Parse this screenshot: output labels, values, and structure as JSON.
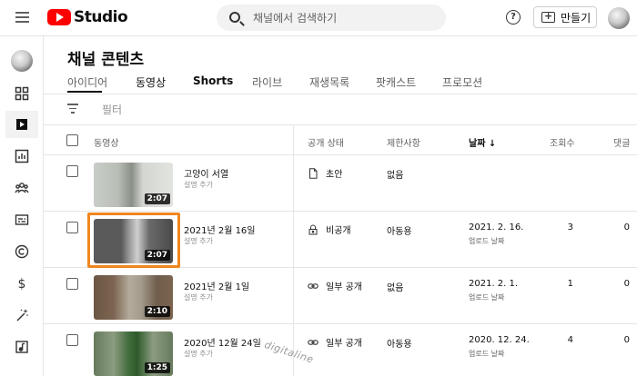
{
  "app": {
    "logo_text": "Studio"
  },
  "header": {
    "search_placeholder": "채널에서 검색하기",
    "help_symbol": "?",
    "create_label": "만들기"
  },
  "sidebar": {
    "items": [
      {
        "icon": "dashboard-icon",
        "active": false
      },
      {
        "icon": "content-icon",
        "active": true
      },
      {
        "icon": "analytics-icon",
        "active": false
      },
      {
        "icon": "community-icon",
        "active": false
      },
      {
        "icon": "subtitles-icon",
        "active": false
      },
      {
        "icon": "copyright-icon",
        "active": false
      },
      {
        "icon": "earn-icon",
        "active": false
      },
      {
        "icon": "customization-icon",
        "active": false
      },
      {
        "icon": "audio-library-icon",
        "active": false
      }
    ]
  },
  "page": {
    "title": "채널 콘텐츠"
  },
  "tabs": [
    {
      "label": "아이디어",
      "active": false
    },
    {
      "label": "동영상",
      "active": true
    },
    {
      "label": "Shorts",
      "active": false
    },
    {
      "label": "라이브",
      "active": false
    },
    {
      "label": "재생목록",
      "active": false
    },
    {
      "label": "팟캐스트",
      "active": false
    },
    {
      "label": "프로모션",
      "active": false
    }
  ],
  "filter": {
    "label": "필터"
  },
  "table": {
    "headers": {
      "video": "동영상",
      "visibility": "공개 상태",
      "restrictions": "제한사항",
      "date": "날짜 ↓",
      "views": "조회수",
      "comments": "댓글"
    },
    "rows": [
      {
        "title": "고양이 서열",
        "subtitle": "설명 추가",
        "duration": "2:07",
        "visibility": "초안",
        "visibility_icon": "draft-icon",
        "restriction": "없음",
        "date": "",
        "date_sub": "",
        "views": "",
        "comments": "",
        "thumb_colors": [
          "#c9cdc8",
          "#8a9088",
          "#e2e4e0"
        ]
      },
      {
        "title": "2021년 2월 16일",
        "subtitle": "설명 추가",
        "duration": "2:07",
        "visibility": "비공개",
        "visibility_icon": "lock-icon",
        "restriction": "아동용",
        "date": "2021. 2. 16.",
        "date_sub": "업로드 날짜",
        "views": "3",
        "comments": "0",
        "thumb_colors": [
          "#5a5a5a",
          "#9a9a9a",
          "#4a4a4a"
        ]
      },
      {
        "title": "2021년 2월 1일",
        "subtitle": "설명 추가",
        "duration": "2:10",
        "visibility": "일부 공개",
        "visibility_icon": "link-icon",
        "restriction": "없음",
        "date": "2021. 2. 1.",
        "date_sub": "업로드 날짜",
        "views": "1",
        "comments": "0",
        "thumb_colors": [
          "#6b5744",
          "#b4ab9c",
          "#7c6450"
        ]
      },
      {
        "title": "2020년 12월 24일",
        "subtitle": "설명 추가",
        "duration": "1:25",
        "visibility": "일부 공개",
        "visibility_icon": "link-icon",
        "restriction": "아동용",
        "date": "2020. 12. 24.",
        "date_sub": "업로드 날짜",
        "views": "4",
        "comments": "0",
        "thumb_colors": [
          "#667a5c",
          "#3f6a3a",
          "#8c9c80"
        ]
      }
    ]
  },
  "watermark": "digitaline",
  "colors": {
    "brand_red": "#ff0000",
    "highlight_orange": "#f0861e"
  }
}
